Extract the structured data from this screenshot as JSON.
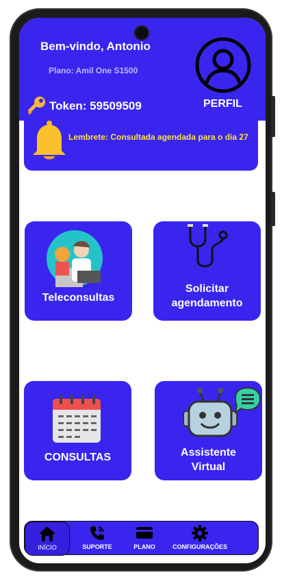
{
  "header": {
    "welcome": "Bem-vindo, Antonio",
    "plan": "Plano: Amil One S1500",
    "token": "Token: 59509509",
    "profile_label": "PERFIL",
    "reminder": "Lembrete: Consultada agendada para o dia 27"
  },
  "cards": {
    "teleconsultas": "Teleconsultas",
    "solicitar": [
      "Solicitar",
      "agendamento"
    ],
    "consultas": "CONSULTAS",
    "assistente": [
      "Assistente",
      "Virtual"
    ]
  },
  "nav": {
    "inicio": "INÍCIO",
    "suporte": "SUPORTE",
    "plano": "PLANO",
    "configuracoes": "CONFIGURAÇÕES"
  },
  "colors": {
    "primary": "#3a25ee",
    "reminder_text": "#ffe23a",
    "plan_text": "#b9b8ff"
  },
  "icons": [
    "key-icon",
    "user-profile-icon",
    "bell-icon",
    "doctor-icon",
    "stethoscope-icon",
    "calendar-icon",
    "robot-icon",
    "home-icon",
    "phone-icon",
    "card-icon",
    "gear-icon"
  ]
}
